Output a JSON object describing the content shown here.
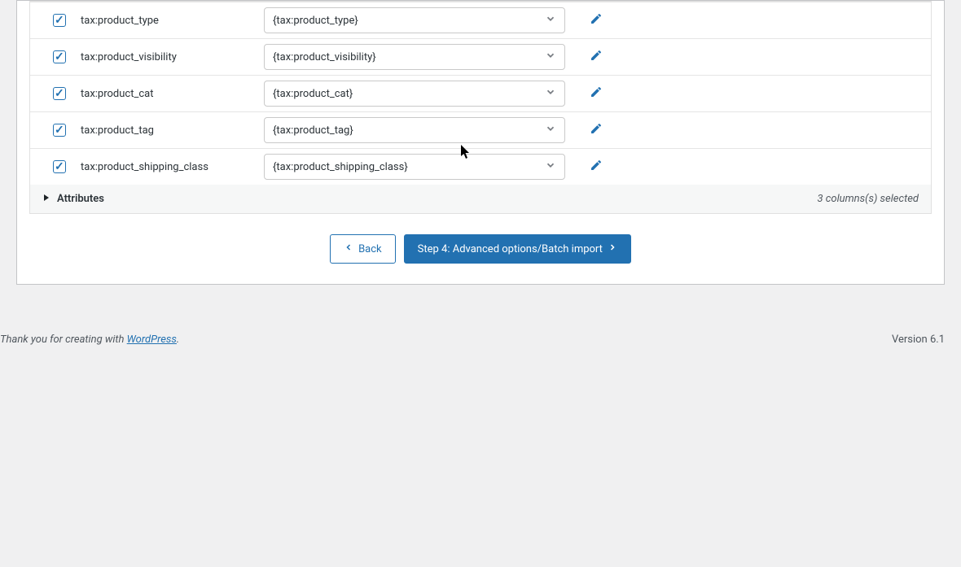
{
  "rows": [
    {
      "label": "tax:product_type",
      "value": "{tax:product_type}"
    },
    {
      "label": "tax:product_visibility",
      "value": "{tax:product_visibility}"
    },
    {
      "label": "tax:product_cat",
      "value": "{tax:product_cat}"
    },
    {
      "label": "tax:product_tag",
      "value": "{tax:product_tag}"
    },
    {
      "label": "tax:product_shipping_class",
      "value": "{tax:product_shipping_class}"
    }
  ],
  "section": {
    "title": "Attributes",
    "selected_text": "3 columns(s) selected"
  },
  "buttons": {
    "back": "Back",
    "next": "Step 4: Advanced options/Batch import"
  },
  "footer": {
    "thanks_prefix": "Thank you for creating with ",
    "link_text": "WordPress",
    "thanks_suffix": ".",
    "version": "Version 6.1"
  }
}
